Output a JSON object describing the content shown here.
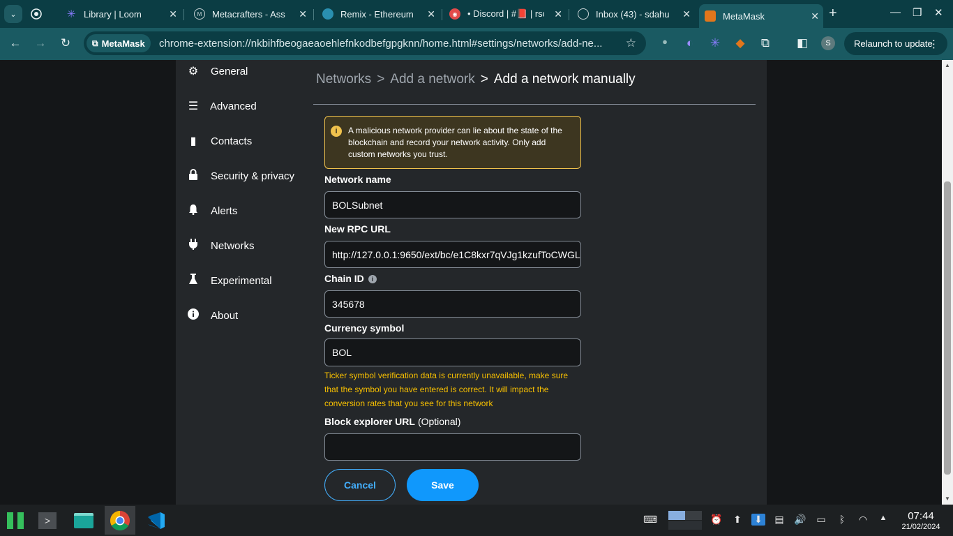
{
  "browser": {
    "tabs": [
      {
        "label": "",
        "icon": "github-icon"
      },
      {
        "label": "Library | Loom",
        "icon": "loom-icon"
      },
      {
        "label": "Metacrafters - Ass",
        "icon": "metacrafters-icon"
      },
      {
        "label": "Remix - Ethereum",
        "icon": "remix-icon"
      },
      {
        "label": "• Discord | #📕 | rsc",
        "icon": "discord-icon"
      },
      {
        "label": "Inbox (43) - sdahu",
        "icon": "gmail-icon"
      },
      {
        "label": "MetaMask",
        "icon": "metamask-icon"
      }
    ],
    "extension_chip": "MetaMask",
    "url": "chrome-extension://nkbihfbeogaeaoehlefnkodbefgpgknn/home.html#settings/networks/add-ne...",
    "relaunch_label": "Relaunch to update",
    "profile_initial": "S"
  },
  "sidebar": {
    "items": [
      {
        "label": "General",
        "icon": "gear-icon"
      },
      {
        "label": "Advanced",
        "icon": "sliders-icon"
      },
      {
        "label": "Contacts",
        "icon": "book-icon"
      },
      {
        "label": "Security & privacy",
        "icon": "lock-icon"
      },
      {
        "label": "Alerts",
        "icon": "bell-icon"
      },
      {
        "label": "Networks",
        "icon": "plug-icon"
      },
      {
        "label": "Experimental",
        "icon": "flask-icon"
      },
      {
        "label": "About",
        "icon": "info-icon"
      }
    ]
  },
  "breadcrumb": {
    "networks": "Networks",
    "add_network": "Add a network",
    "current": "Add a network manually",
    "separator": ">"
  },
  "warning": {
    "text": "A malicious network provider can lie about the state of the blockchain and record your network activity. Only add custom networks you trust."
  },
  "form": {
    "network_name_label": "Network name",
    "network_name_value": "BOLSubnet",
    "rpc_url_label": "New RPC URL",
    "rpc_url_value": "http://127.0.0.1:9650/ext/bc/e1C8kxr7qVJg1kzufToCWGL",
    "chain_id_label": "Chain ID",
    "chain_id_value": "345678",
    "currency_label": "Currency symbol",
    "currency_value": "BOL",
    "currency_error": "Ticker symbol verification data is currently unavailable, make sure that the symbol you have entered is correct. It will impact the conversion rates that you see for this network",
    "explorer_label": "Block explorer URL",
    "explorer_optional": "(Optional)",
    "explorer_value": "",
    "cancel_label": "Cancel",
    "save_label": "Save"
  },
  "taskbar": {
    "time": "07:44",
    "date": "21/02/2024"
  },
  "colors": {
    "accent": "#1098fc",
    "warning_border": "#f0c24d",
    "error_text": "#f8c000",
    "panel_bg": "#24272a",
    "chrome_frame": "#0b3d44"
  }
}
